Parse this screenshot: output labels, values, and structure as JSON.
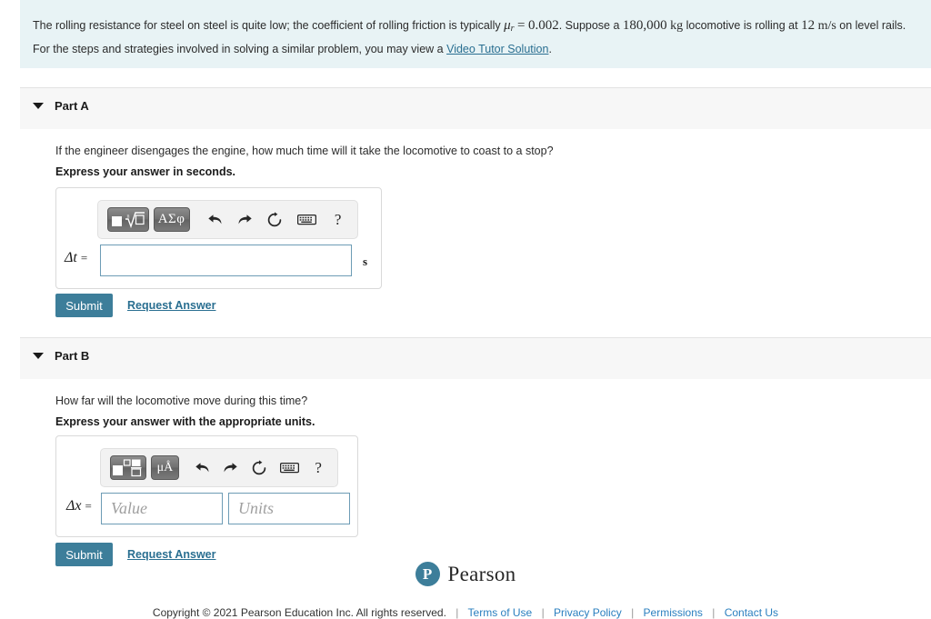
{
  "problem": {
    "line1_before_mu": "The rolling resistance for steel on steel is quite low; the coefficient of rolling friction is typically",
    "mu_symbol": "μ",
    "mu_subscript": "r",
    "mu_equals": "=",
    "mu_value": "0.002",
    "line1_after_value": ". Suppose a",
    "mass_value": "180,000",
    "mass_unit": "kg",
    "line1_mid": "locomotive is rolling at",
    "speed_value": "12",
    "speed_unit": "m/s",
    "line1_end": "on level rails.",
    "line2_before_link": "For the steps and strategies involved in solving a similar problem, you may view a",
    "link_text": "Video Tutor Solution",
    "line2_after_link": "."
  },
  "part_a": {
    "title": "Part A",
    "question": "If the engineer disengages the engine, how much time will it take the locomotive to coast to a stop?",
    "instruction": "Express your answer in seconds.",
    "toolbar": {
      "template_button": "template-sqrt",
      "greek_button": "ΑΣφ",
      "undo": "undo-arrow",
      "redo": "redo-arrow",
      "reset": "reset-circle",
      "keyboard": "keyboard",
      "help": "?"
    },
    "equation_label": "Δt",
    "equals": "=",
    "input_value": "",
    "input_placeholder": "",
    "unit_suffix": "s",
    "submit_label": "Submit",
    "request_answer_label": "Request Answer"
  },
  "part_b": {
    "title": "Part B",
    "question": "How far will the locomotive move during this time?",
    "instruction": "Express your answer with the appropriate units.",
    "toolbar": {
      "template_button": "template-boxes",
      "units_button": "μÅ",
      "undo": "undo-arrow",
      "redo": "redo-arrow",
      "reset": "reset-circle",
      "keyboard": "keyboard",
      "help": "?"
    },
    "equation_label": "Δx",
    "equals": "=",
    "value_input": "",
    "value_placeholder": "Value",
    "units_input": "",
    "units_placeholder": "Units",
    "submit_label": "Submit",
    "request_answer_label": "Request Answer"
  },
  "footer": {
    "logo_letter": "P",
    "brand": "Pearson",
    "copyright": "Copyright © 2021 Pearson Education Inc. All rights reserved.",
    "links": [
      "Terms of Use",
      "Privacy Policy",
      "Permissions",
      "Contact Us"
    ],
    "separator": "|"
  },
  "colors": {
    "banner_bg": "#e8f3f5",
    "band_bg": "#f7f7f7",
    "accent": "#3d7e9a",
    "link": "#2a6f91",
    "input_border": "#6d9cb5"
  }
}
